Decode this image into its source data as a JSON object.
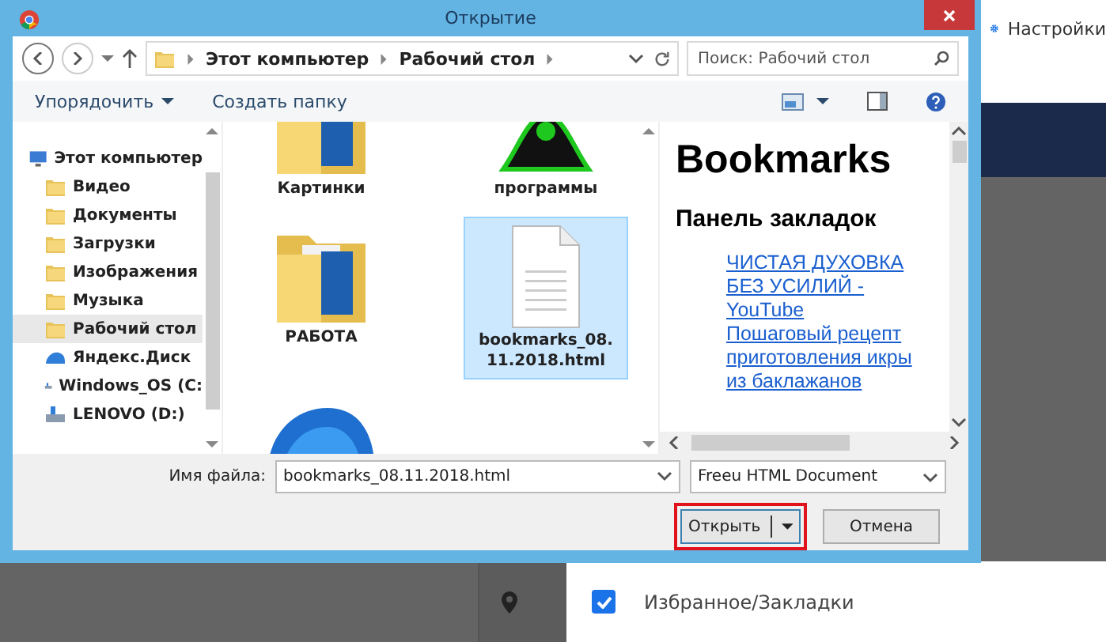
{
  "window": {
    "title": "Открытие"
  },
  "address": {
    "path": [
      "Этот компьютер",
      "Рабочий стол"
    ],
    "search_placeholder": "Поиск: Рабочий стол"
  },
  "toolbar": {
    "organize": "Упорядочить",
    "new_folder": "Создать папку"
  },
  "nav": [
    {
      "label": "Этот компьютер",
      "kind": "computer",
      "selected": false,
      "children": [
        {
          "label": "Видео",
          "kind": "folder",
          "selected": false
        },
        {
          "label": "Документы",
          "kind": "folder",
          "selected": false
        },
        {
          "label": "Загрузки",
          "kind": "folder",
          "selected": false
        },
        {
          "label": "Изображения",
          "kind": "folder",
          "selected": false
        },
        {
          "label": "Музыка",
          "kind": "folder",
          "selected": false
        },
        {
          "label": "Рабочий стол",
          "kind": "folder",
          "selected": true
        },
        {
          "label": "Яндекс.Диск",
          "kind": "cloud",
          "selected": false
        },
        {
          "label": "Windows_OS (C:",
          "kind": "drive",
          "selected": false
        },
        {
          "label": "LENOVO (D:)",
          "kind": "drive",
          "selected": false
        }
      ]
    }
  ],
  "files": [
    {
      "label": "Картинки",
      "kind": "folder",
      "selected": false
    },
    {
      "label": "программы",
      "kind": "program",
      "selected": false
    },
    {
      "label": "РАБОТА",
      "kind": "folder",
      "selected": false
    },
    {
      "label": "bookmarks_08.11.2018.html",
      "kind": "document",
      "selected": true
    },
    {
      "kind": "cloud",
      "selected": false
    }
  ],
  "preview": {
    "heading": "Bookmarks",
    "subheading": "Панель закладок",
    "links": [
      "ЧИСТАЯ ДУХОВКА БЕЗ УСИЛИЙ - YouTube",
      "Пошаговый рецепт приготовления икры из баклажанов"
    ]
  },
  "filename": {
    "label": "Имя файла:",
    "value": "bookmarks_08.11.2018.html"
  },
  "filetype": "Freeu HTML Document",
  "buttons": [
    {
      "label": "Открыть",
      "kind": "split",
      "highlighted": true
    },
    {
      "label": "Отмена",
      "kind": "plain",
      "highlighted": false
    }
  ],
  "background": {
    "settings": "Настройки",
    "checkbox": {
      "label": "Избранное/Закладки",
      "checked": true
    }
  }
}
